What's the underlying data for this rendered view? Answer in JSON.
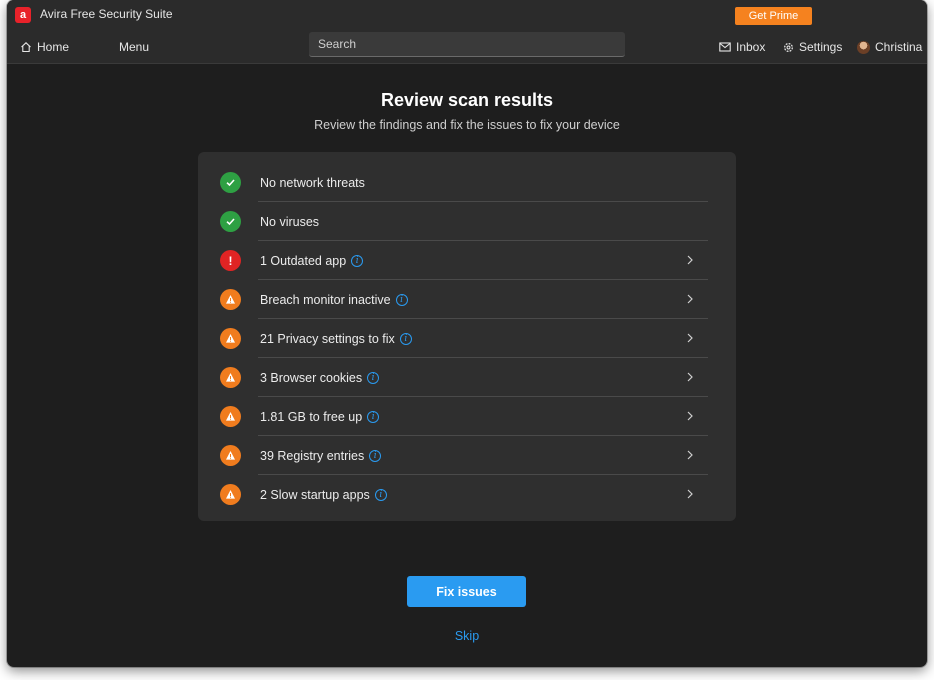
{
  "window": {
    "title": "Avira Free Security Suite",
    "get_prime_label": "Get Prime"
  },
  "nav": {
    "home_label": "Home",
    "menu_label": "Menu",
    "search_placeholder": "Search",
    "inbox_label": "Inbox",
    "settings_label": "Settings",
    "user_name": "Christina"
  },
  "main": {
    "title": "Review scan results",
    "subtitle": "Review the findings and fix the issues to fix your device",
    "fix_button_label": "Fix issues",
    "skip_label": "Skip"
  },
  "results": [
    {
      "label": "No network threats",
      "status": "ok",
      "icon": "checkmark-icon",
      "info": false,
      "chevron": false
    },
    {
      "label": "No viruses",
      "status": "ok",
      "icon": "checkmark-icon",
      "info": false,
      "chevron": false
    },
    {
      "label": "1 Outdated app",
      "status": "error",
      "icon": "exclamation-icon",
      "info": true,
      "chevron": true
    },
    {
      "label": "Breach monitor inactive",
      "status": "warning",
      "icon": "warning-icon",
      "info": true,
      "chevron": true
    },
    {
      "label": "21 Privacy settings to fix",
      "status": "warning",
      "icon": "warning-icon",
      "info": true,
      "chevron": true
    },
    {
      "label": "3 Browser cookies",
      "status": "warning",
      "icon": "warning-icon",
      "info": true,
      "chevron": true
    },
    {
      "label": "1.81 GB to free up",
      "status": "warning",
      "icon": "warning-icon",
      "info": true,
      "chevron": true
    },
    {
      "label": "39 Registry entries",
      "status": "warning",
      "icon": "warning-icon",
      "info": true,
      "chevron": true
    },
    {
      "label": "2 Slow startup apps",
      "status": "warning",
      "icon": "warning-icon",
      "info": true,
      "chevron": true
    }
  ],
  "colors": {
    "accent": "#2a9bf1",
    "ok": "#2ea043",
    "error": "#e02424",
    "warning": "#f07c1e",
    "prime": "#f5821f"
  }
}
